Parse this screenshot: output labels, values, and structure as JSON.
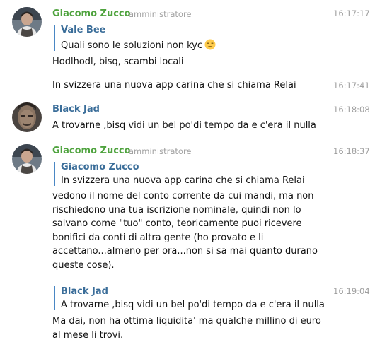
{
  "messages": [
    {
      "author": "Giacomo Zucco",
      "role": "amministratore",
      "time": "16:17:17",
      "reply": {
        "author": "Vale Bee",
        "text": "Quali sono le soluzioni non kyc",
        "emoji": "unamused-face"
      },
      "text": "Hodlhodl, bisq, scambi locali"
    },
    {
      "time": "16:17:41",
      "text": "In svizzera una nuova app carina che si chiama Relai"
    },
    {
      "author": "Black Jad",
      "time": "16:18:08",
      "text": "A trovarne ,bisq vidi un bel po'di tempo da e c'era il nulla"
    },
    {
      "author": "Giacomo Zucco",
      "role": "amministratore",
      "time": "16:18:37",
      "reply": {
        "author": "Giacomo Zucco",
        "text": "In svizzera una nuova app carina che si chiama Relai"
      },
      "lines": [
        "vedono il nome del conto corrente da cui mandi, ma non",
        "rischiedono una tua iscrizione nominale, quindi non lo",
        "salvano come \"tuo\" conto, teoricamente puoi ricevere",
        "bonifici da conti di altra gente (ho provato e li",
        "accettano...almeno per ora...non si sa mai quanto durano",
        "queste cose)."
      ]
    },
    {
      "time": "16:19:04",
      "reply": {
        "author": "Black Jad",
        "text": "A trovarne ,bisq vidi un bel po'di tempo da e c'era il nulla"
      },
      "lines": [
        "Ma dai, non ha ottima liquidita' ma qualche millino di euro",
        "al mese li trovi."
      ]
    }
  ],
  "colors": {
    "admin_name": "#4fa33e",
    "user_name": "#3a6d99",
    "quote_bar": "#4a87c4",
    "timestamp": "#a0a0a0"
  }
}
